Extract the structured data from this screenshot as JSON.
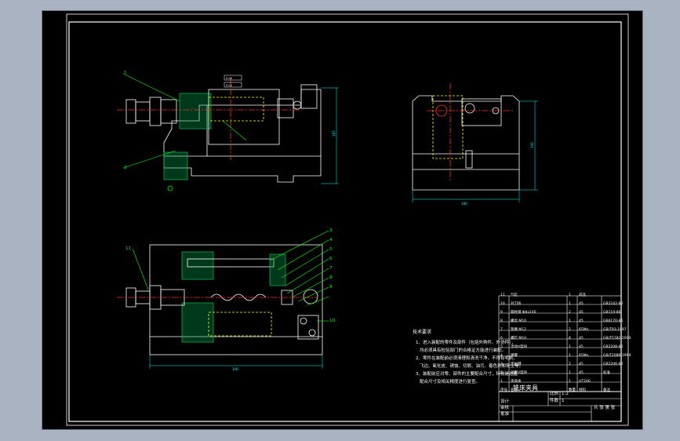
{
  "drawing": {
    "technical_requirements": {
      "title": "技术要求",
      "items": [
        "1、进入装配的零件及部件（包括外购件、外协件），",
        "均必须具有检验部门的合格证方能进行装配。",
        "2、零件在装配前必须清理和清洗干净，不得有毛刺、",
        "飞边、氧化皮、锈蚀、切屑、油污、着色剂和灰尘等。",
        "3、装配前应对零、部件的主要配合尺寸，特别是过盈",
        "配合尺寸及相关精度进行复查。"
      ]
    },
    "title_block": {
      "name": "铣床夹具",
      "scale_label": "比例",
      "scale": "1:2",
      "sheet_label": "件数",
      "sheet": "1",
      "weight_label": "重量",
      "rows": [
        "设计",
        "审核",
        "批准"
      ],
      "sheet_count": "共 张 第 张"
    },
    "parts_list": {
      "header": {
        "no": "序号",
        "name": "名称",
        "qty": "数量",
        "material": "材料",
        "remark": "备注"
      },
      "rows": [
        {
          "no": "11",
          "name": "气缸",
          "qty": "1",
          "material": "成品",
          "remark": ""
        },
        {
          "no": "10",
          "name": "对刀块",
          "qty": "1",
          "material": "45",
          "remark": "GB2242-80"
        },
        {
          "no": "9",
          "name": "圆柱销 Φ8x100",
          "qty": "2",
          "material": "45",
          "remark": "GB119-86"
        },
        {
          "no": "8",
          "name": "螺母 M10",
          "qty": "1",
          "material": "45",
          "remark": "GB6170-86"
        },
        {
          "no": "7",
          "name": "垫圈 M12",
          "qty": "2",
          "material": "65Mn",
          "remark": "GB/T93-1987"
        },
        {
          "no": "6",
          "name": "螺钉 M10",
          "qty": "4",
          "material": "45",
          "remark": "GB/T5782-2000"
        },
        {
          "no": "5",
          "name": "活动V型块",
          "qty": "1",
          "material": "45",
          "remark": "GB2208-80"
        },
        {
          "no": "4",
          "name": "弹簧",
          "qty": "1",
          "material": "65Mn",
          "remark": "GB/T2089-1994"
        },
        {
          "no": "3",
          "name": "定位键",
          "qty": "2",
          "material": "45",
          "remark": "GB2206-80"
        },
        {
          "no": "2",
          "name": "固定V型块",
          "qty": "1",
          "material": "45",
          "remark": "标准"
        },
        {
          "no": "1",
          "name": "夹具体",
          "qty": "1",
          "material": "HT200",
          "remark": ""
        }
      ]
    },
    "dimensions": {
      "front_width": "342",
      "front_height": "183",
      "side_width": "180",
      "side_height": "150",
      "top_width": "340",
      "tol_1": "0.05",
      "tol_2": "0.05"
    },
    "balloons": [
      "1",
      "2",
      "3",
      "4",
      "5",
      "6",
      "7",
      "8",
      "9",
      "10",
      "11"
    ],
    "colors": {
      "background": "#000000",
      "outline": "#ffffff",
      "leader": "#00ff00",
      "hidden": "#ffff00",
      "center": "#ff3030",
      "section": "#00b050",
      "dimension": "#00ffff"
    }
  }
}
